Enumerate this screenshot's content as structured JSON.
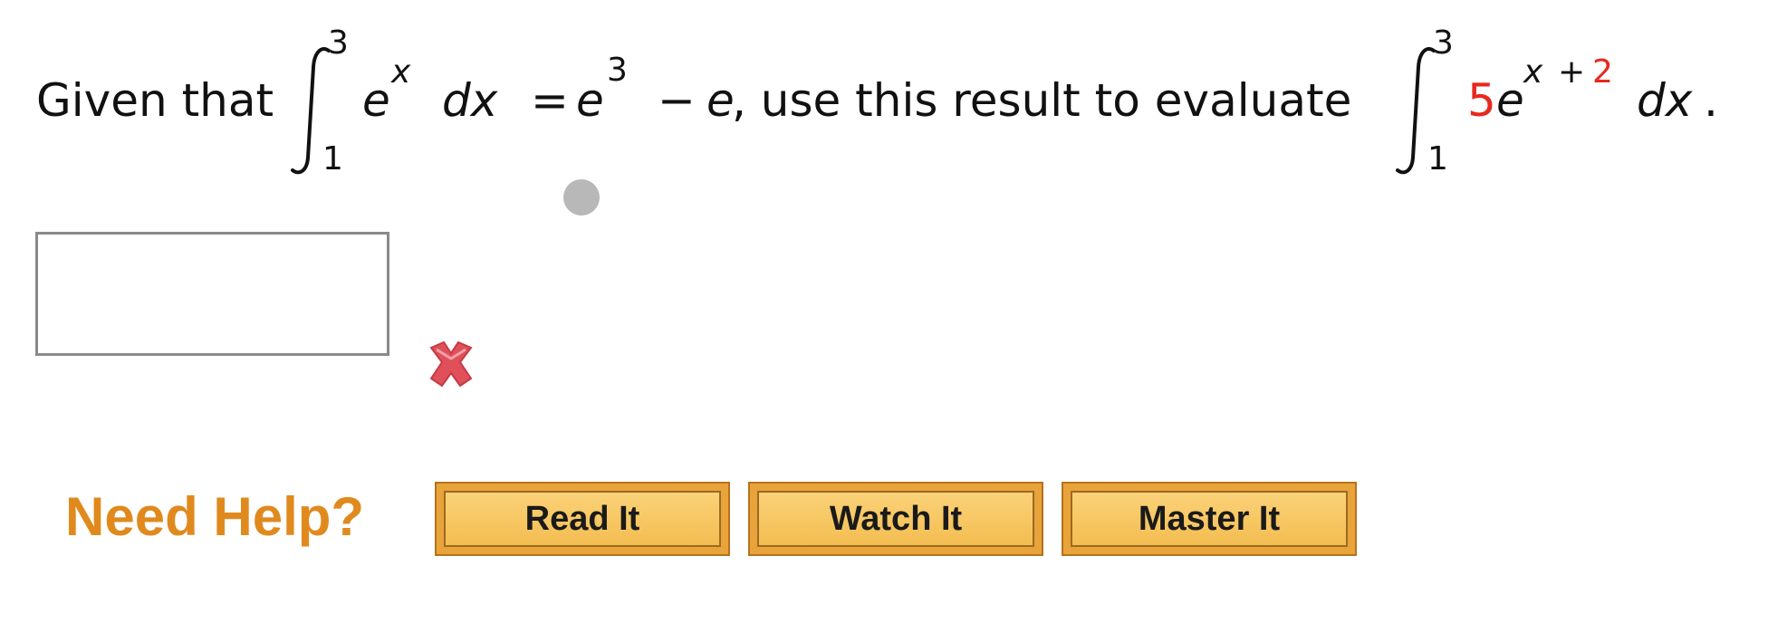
{
  "question": {
    "given_label": "Given that",
    "integral1": {
      "upper": "3",
      "lower": "1"
    },
    "integrand1_base": "e",
    "integrand1_exp": "x",
    "differential1": "dx",
    "equals": "=",
    "rhs_base": "e",
    "rhs_exp": "3",
    "rhs_minus": "−",
    "rhs_e": "e",
    "middle_text": ", use this result to evaluate",
    "integral2": {
      "upper": "3",
      "lower": "1"
    },
    "coefficient": "5",
    "integrand2_base": "e",
    "integrand2_exp_var": "x",
    "integrand2_exp_plus": "+",
    "integrand2_exp_const": "2",
    "differential2": "dx",
    "end_punct": "."
  },
  "answer": {
    "value": "",
    "status": "incorrect"
  },
  "help": {
    "label": "Need Help?",
    "buttons": [
      {
        "label": "Read It"
      },
      {
        "label": "Watch It"
      },
      {
        "label": "Master It"
      }
    ]
  },
  "colors": {
    "highlight": "#e8281e",
    "help_label": "#e08a1e",
    "button_fill": "#f3bd51",
    "incorrect_mark": "#e0505a"
  }
}
